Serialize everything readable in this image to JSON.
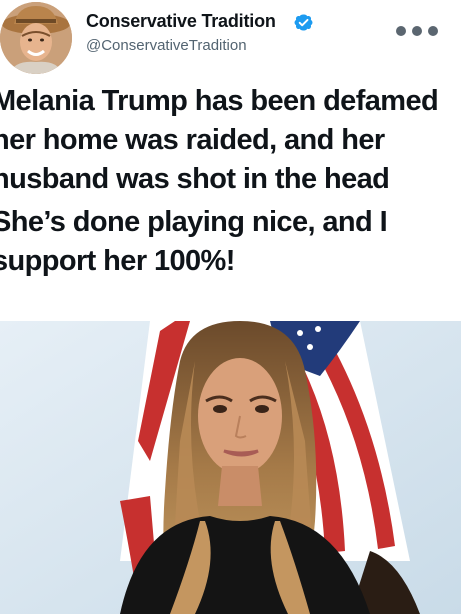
{
  "post": {
    "author": {
      "display_name": "Conservative Tradition",
      "handle": "@ConservativeTradition",
      "verified_icon": "verified-badge-icon",
      "avatar_icon": "profile-avatar"
    },
    "more_icon": "more-options-icon",
    "text": {
      "paragraph_1": [
        "Melania Trump has been defamed",
        "her home was raided, and her",
        "husband was shot in the head"
      ],
      "paragraph_2": [
        "She’s done playing nice, and I",
        "support her 100%!"
      ]
    },
    "media": {
      "type": "photo"
    }
  },
  "colors": {
    "verified_blue": "#1d9bf0",
    "text_primary": "#0f1419",
    "text_secondary": "#536471"
  }
}
